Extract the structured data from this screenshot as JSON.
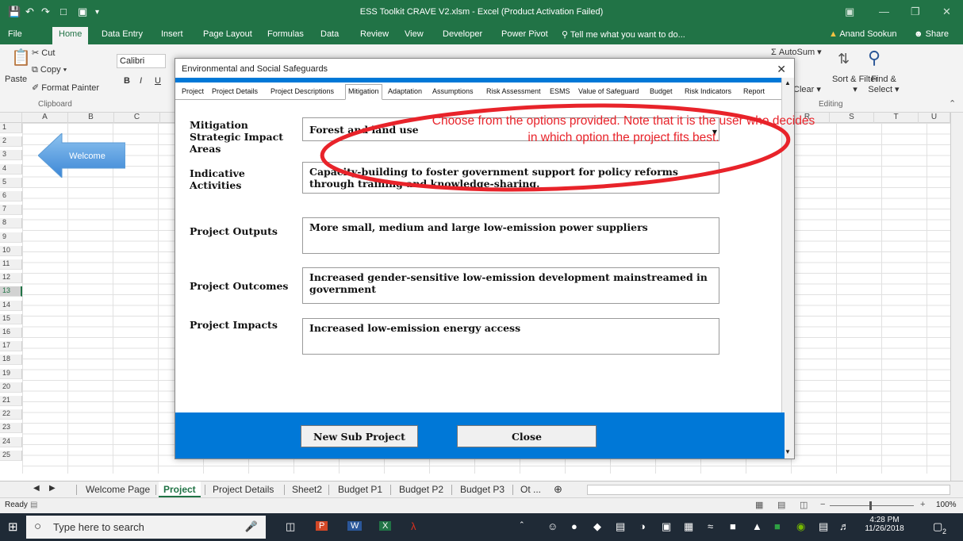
{
  "window": {
    "title": "ESS Toolkit CRAVE V2.xlsm  -  Excel (Product Activation Failed)"
  },
  "ribbon_tabs": [
    "File",
    "Home",
    "Data Entry",
    "Insert",
    "Page Layout",
    "Formulas",
    "Data",
    "Review",
    "View",
    "Developer",
    "Power Pivot"
  ],
  "tell_me": "Tell me what you want to do...",
  "user": "Anand Sookun",
  "share": "Share",
  "ribbon": {
    "paste": "Paste",
    "cut": "Cut",
    "copy": "Copy",
    "format_painter": "Format Painter",
    "clipboard": "Clipboard",
    "font_name": "Calibri",
    "bold": "B",
    "italic": "I",
    "underline": "U",
    "autosum": "AutoSum",
    "clear": "Clear",
    "sort_filter": "Sort & Filter",
    "find_select": "Find & Select",
    "editing": "Editing"
  },
  "columns_left": [
    "A",
    "B",
    "C"
  ],
  "columns_right": [
    "R",
    "S",
    "T",
    "U"
  ],
  "rows": [
    "1",
    "2",
    "3",
    "4",
    "5",
    "6",
    "7",
    "8",
    "9",
    "10",
    "11",
    "12",
    "13",
    "14",
    "15",
    "16",
    "17",
    "18",
    "19",
    "20",
    "21",
    "22",
    "23",
    "24",
    "25"
  ],
  "selected_row": "13",
  "welcome_button": "Welcome",
  "dialog": {
    "title": "Environmental and Social Safeguards",
    "tabs": [
      "Project",
      "Project Details",
      "Project Descriptions",
      "Mitigation",
      "Adaptation",
      "Assumptions",
      "Risk Assessment",
      "ESMS",
      "Value of Safeguard",
      "Budget",
      "Risk Indicators",
      "Report"
    ],
    "active_tab": "Mitigation",
    "fields": {
      "strategic_label": "Mitigation Strategic Impact Areas",
      "strategic_value": "Forest and land use",
      "activities_label": "Indicative Activities",
      "activities_value": "Capacity-building to foster government support for policy reforms through training and knowledge-sharing.",
      "outputs_label": "Project Outputs",
      "outputs_value": "More small, medium and large low-emission power suppliers",
      "outcomes_label": "Project Outcomes",
      "outcomes_value": "Increased gender-sensitive low-emission development mainstreamed in government",
      "impacts_label": "Project Impacts",
      "impacts_value": "Increased low-emission energy access"
    },
    "buttons": {
      "new_sub_project": "New Sub Project",
      "close": "Close"
    }
  },
  "annotation": {
    "text": "Choose from the options provided. Note that it is the user who decides in which option the project fits best.",
    "color": "#e8232a"
  },
  "sheet_tabs": [
    "Welcome Page",
    "Project",
    "Project Details",
    "Sheet2",
    "Budget P1",
    "Budget P2",
    "Budget P3",
    "Ot ..."
  ],
  "active_sheet": "Project",
  "status": {
    "ready": "Ready",
    "zoom": "100%"
  },
  "taskbar": {
    "search_placeholder": "Type here to search",
    "time": "4:28 PM",
    "date": "11/26/2018",
    "notifications": "2"
  },
  "colors": {
    "excel_green": "#217346",
    "dialog_blue": "#0078d7",
    "taskbar": "#1f2a36"
  },
  "icons": [
    "save-icon",
    "undo-icon",
    "redo-icon",
    "new-icon",
    "print-preview-icon",
    "windows-start-icon",
    "cortana-circle-icon",
    "task-view-icon",
    "powerpoint-icon",
    "word-icon",
    "excel-icon",
    "acrobat-icon"
  ]
}
